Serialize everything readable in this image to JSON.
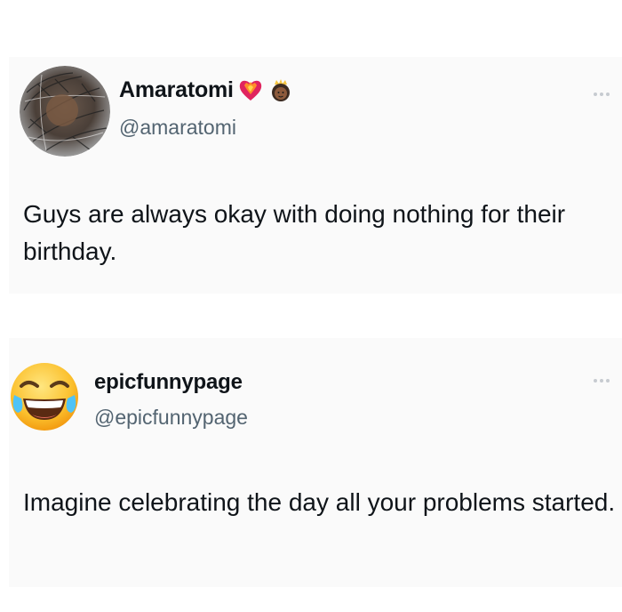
{
  "tweets": [
    {
      "name": "Amaratomi",
      "handle": "@amaratomi",
      "badges": [
        "heart-on-fire-icon",
        "princess-icon"
      ],
      "text": "Guys are always okay with doing nothing for their birthday.",
      "avatar": "sketched-portrait"
    },
    {
      "name": "epicfunnypage",
      "handle": "@epicfunnypage",
      "badges": [],
      "text": "Imagine celebrating the day all your problems started.",
      "avatar": "tears-of-joy-emoji"
    }
  ],
  "colors": {
    "name": "#0f1419",
    "handle": "#536471",
    "text": "#0f1419",
    "card_bg": "#fafafa"
  }
}
